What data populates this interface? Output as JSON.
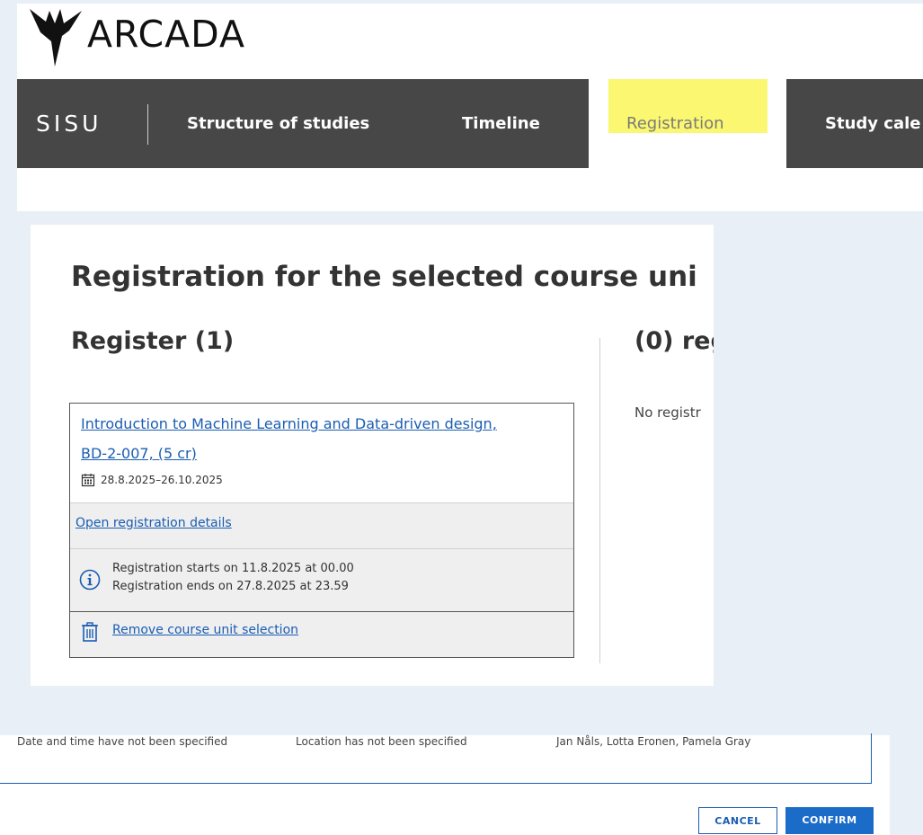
{
  "header": {
    "logo_text": "ARCADA",
    "app_name": "SISU",
    "nav": {
      "structure": "Structure of studies",
      "timeline": "Timeline",
      "registration": "Registration",
      "study_calendar": "Study cale"
    },
    "highlight_color": "#fbf771"
  },
  "registration": {
    "title": "Registration for the selected course uni",
    "register_heading": "Register (1)",
    "right_heading": "(0) reg",
    "no_registrations": "No registr",
    "course": {
      "name_line1": "Introduction to Machine Learning and Data-driven design,",
      "name_line2": "BD-2-007, (5 cr)",
      "dates": "28.8.2025–26.10.2025",
      "open_details": "Open registration details",
      "reg_starts": "Registration starts on 11.8.2025 at 00.00",
      "reg_ends": "Registration ends on 27.8.2025 at 23.59",
      "remove": "Remove course unit selection"
    }
  },
  "bottom": {
    "date_time": "Date and time have not been specified",
    "location": "Location has not been specified",
    "teachers": "Jan Nåls, Lotta Eronen, Pamela Gray",
    "cancel_label": "CANCEL",
    "confirm_label": "CONFIRM"
  },
  "colors": {
    "navbar": "#474747",
    "link": "#1a5db3",
    "confirm": "#1a6cc8"
  }
}
